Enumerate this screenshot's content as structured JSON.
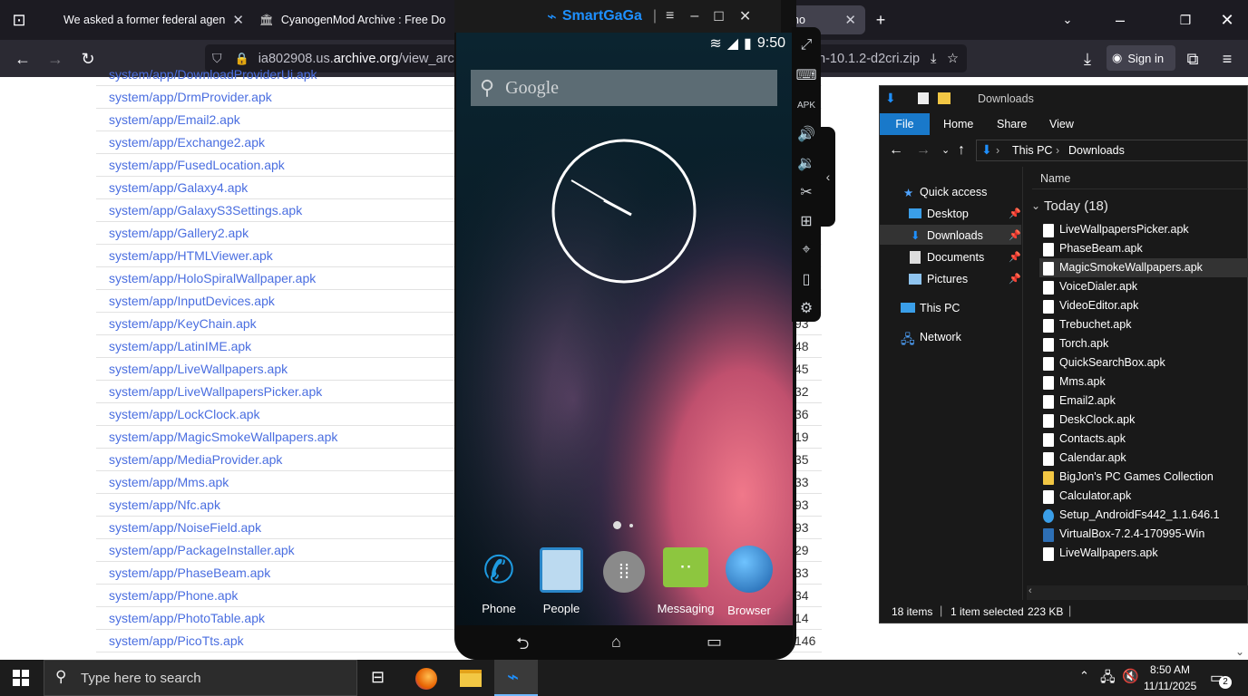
{
  "browser": {
    "tabs": [
      {
        "title": "We asked a former federal agen"
      },
      {
        "title": "CyanogenMod Archive : Free Do"
      },
      {
        "title": "no"
      }
    ],
    "url_prefix": "ia802908.us.",
    "url_host": "archive.org",
    "url_path": "/view_archiv",
    "url_tail": "n-10.1.2-d2cri.zip",
    "sign_in": "Sign in"
  },
  "file_list": [
    {
      "name": "system/app/DownloadProviderUi.apk",
      "num": ""
    },
    {
      "name": "system/app/DrmProvider.apk",
      "num": ""
    },
    {
      "name": "system/app/Email2.apk",
      "num": ""
    },
    {
      "name": "system/app/Exchange2.apk",
      "num": ""
    },
    {
      "name": "system/app/FusedLocation.apk",
      "num": ""
    },
    {
      "name": "system/app/Galaxy4.apk",
      "num": ""
    },
    {
      "name": "system/app/GalaxyS3Settings.apk",
      "num": ""
    },
    {
      "name": "system/app/Gallery2.apk",
      "num": ""
    },
    {
      "name": "system/app/HTMLViewer.apk",
      "num": ""
    },
    {
      "name": "system/app/HoloSpiralWallpaper.apk",
      "num": ""
    },
    {
      "name": "system/app/InputDevices.apk",
      "num": ""
    },
    {
      "name": "system/app/KeyChain.apk",
      "num": "93"
    },
    {
      "name": "system/app/LatinIME.apk",
      "num": "48"
    },
    {
      "name": "system/app/LiveWallpapers.apk",
      "num": "45"
    },
    {
      "name": "system/app/LiveWallpapersPicker.apk",
      "num": "32"
    },
    {
      "name": "system/app/LockClock.apk",
      "num": "36"
    },
    {
      "name": "system/app/MagicSmokeWallpapers.apk",
      "num": "19"
    },
    {
      "name": "system/app/MediaProvider.apk",
      "num": "35"
    },
    {
      "name": "system/app/Mms.apk",
      "num": "33"
    },
    {
      "name": "system/app/Nfc.apk",
      "num": "93"
    },
    {
      "name": "system/app/NoiseField.apk",
      "num": "93"
    },
    {
      "name": "system/app/PackageInstaller.apk",
      "num": "29"
    },
    {
      "name": "system/app/PhaseBeam.apk",
      "num": "33"
    },
    {
      "name": "system/app/Phone.apk",
      "num": "34"
    },
    {
      "name": "system/app/PhotoTable.apk",
      "num": "14"
    },
    {
      "name": "system/app/PicoTts.apk",
      "num": "146"
    }
  ],
  "emulator": {
    "app_name": "SmartGaGa",
    "time": "9:50",
    "search_placeholder": "Google",
    "dock": [
      "Phone",
      "People",
      "",
      "Messaging",
      "Browser"
    ],
    "colors": {
      "accent": "#1e90ff",
      "screen_bg": "#0a1f2a"
    }
  },
  "explorer": {
    "title": "Downloads",
    "ribbon": [
      "File",
      "Home",
      "Share",
      "View"
    ],
    "breadcrumb": [
      "This PC",
      "Downloads"
    ],
    "column": "Name",
    "group": "Today (18)",
    "nav": [
      {
        "label": "Quick access"
      },
      {
        "label": "Desktop"
      },
      {
        "label": "Downloads"
      },
      {
        "label": "Documents"
      },
      {
        "label": "Pictures"
      },
      {
        "label": "This PC"
      },
      {
        "label": "Network"
      }
    ],
    "files": [
      "LiveWallpapersPicker.apk",
      "PhaseBeam.apk",
      "MagicSmokeWallpapers.apk",
      "VoiceDialer.apk",
      "VideoEditor.apk",
      "Trebuchet.apk",
      "Torch.apk",
      "QuickSearchBox.apk",
      "Mms.apk",
      "Email2.apk",
      "DeskClock.apk",
      "Contacts.apk",
      "Calendar.apk",
      "BigJon's PC Games Collection",
      "Calculator.apk",
      "Setup_AndroidFs442_1.1.646.1",
      "VirtualBox-7.2.4-170995-Win",
      "LiveWallpapers.apk"
    ],
    "status_items": "18 items",
    "status_selected": "1 item selected",
    "status_size": "223 KB"
  },
  "taskbar": {
    "search_placeholder": "Type here to search",
    "time": "8:50 AM",
    "date": "11/11/2025",
    "notification_count": "2"
  }
}
